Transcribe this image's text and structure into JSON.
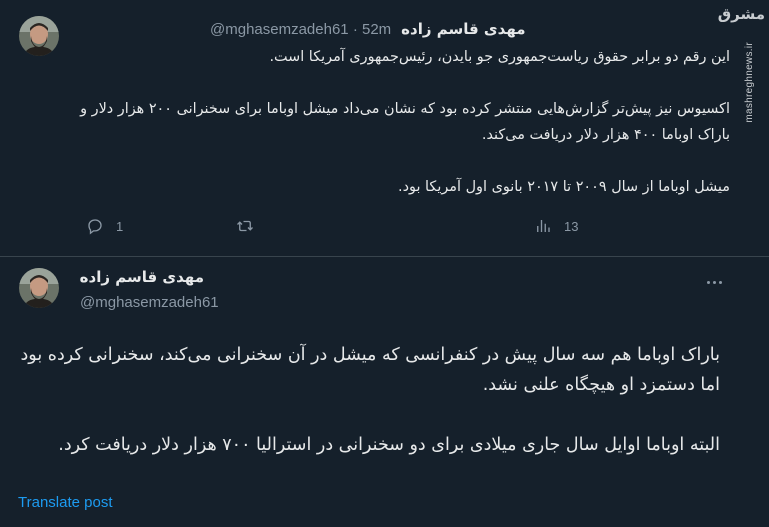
{
  "watermark": {
    "logo": "مشرق",
    "url": "mashreghnews.ir"
  },
  "tweet1": {
    "author": "مهدی قاسم زاده",
    "handle": "@mghasemzadeh61",
    "separator": "·",
    "time": "52m",
    "text": "این رقم دو برابر حقوق ریاست‌جمهوری جو بایدن، رئیس‌جمهوری آمریکا است.\n\nاکسیوس نیز پیش‌تر گزارش‌هایی منتشر کرده بود که نشان می‌داد میشل اوباما برای سخنرانی ۲۰۰ هزار دلار و باراک اوباما ۴۰۰ هزار دلار دریافت می‌کند.\n\nمیشل اوباما از سال ۲۰۰۹ تا ۲۰۱۷ بانوی اول آمریکا بود.",
    "reply_count": "1",
    "view_count": "13",
    "icons": {
      "reply": "reply-icon",
      "retweet": "retweet-icon",
      "views": "views-icon"
    }
  },
  "tweet2": {
    "author": "مهدی قاسم زاده",
    "handle": "@mghasemzadeh61",
    "text": "باراک اوباما هم سه سال پیش در کنفرانسی که میشل در آن سخنرانی می‌کند، سخنرانی کرده بود اما دستمزد او هیچگاه علنی نشد.\n\nالبته اوباما اوایل سال جاری میلادی برای دو سخنرانی در استرالیا ۷۰۰ هزار دلار دریافت کرد.",
    "translate_label": "Translate post"
  },
  "colors": {
    "background": "#15202b",
    "text": "#e7e9ea",
    "muted": "#8b98a5",
    "link": "#1d9bf0",
    "divider": "#38444d"
  }
}
